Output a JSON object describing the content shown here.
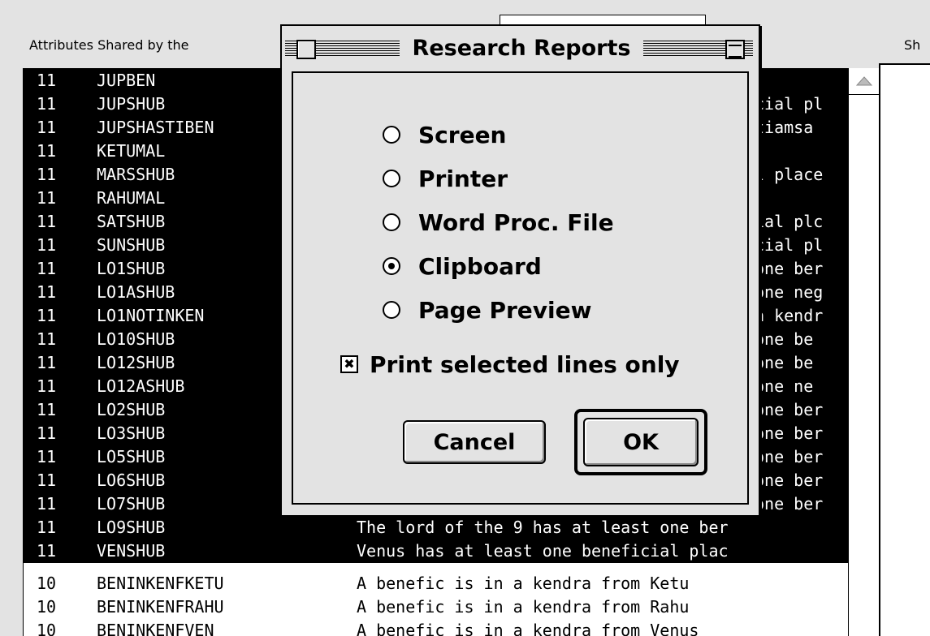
{
  "window": {
    "left_label": "Attributes Shared by the",
    "right_label": "Sh"
  },
  "list": {
    "rows": [
      {
        "count": "11",
        "attr": "JUPBEN",
        "desc": "",
        "selected": true
      },
      {
        "count": "11",
        "attr": "JUPSHUB",
        "desc": "cial pl",
        "selected": true
      },
      {
        "count": "11",
        "attr": "JUPSHASTIBEN",
        "desc": "tiamsa",
        "selected": true
      },
      {
        "count": "11",
        "attr": "KETUMAL",
        "desc": "",
        "selected": true
      },
      {
        "count": "11",
        "attr": "MARSSHUB",
        "desc": "l place",
        "selected": true
      },
      {
        "count": "11",
        "attr": "RAHUMAL",
        "desc": "",
        "selected": true
      },
      {
        "count": "11",
        "attr": "SATSHUB",
        "desc": "ial plc",
        "selected": true
      },
      {
        "count": "11",
        "attr": "SUNSHUB",
        "desc": "cial pl",
        "selected": true
      },
      {
        "count": "11",
        "attr": "LO1SHUB",
        "desc": "one ber",
        "selected": true
      },
      {
        "count": "11",
        "attr": "LO1ASHUB",
        "desc": "one neg",
        "selected": true
      },
      {
        "count": "11",
        "attr": "LO1NOTINKEN",
        "desc": "a kendr",
        "selected": true
      },
      {
        "count": "11",
        "attr": "LO10SHUB",
        "desc": "one be",
        "selected": true
      },
      {
        "count": "11",
        "attr": "LO12SHUB",
        "desc": "one be",
        "selected": true
      },
      {
        "count": "11",
        "attr": "LO12ASHUB",
        "desc": "one ne",
        "selected": true
      },
      {
        "count": "11",
        "attr": "LO2SHUB",
        "desc": "one ber",
        "selected": true
      },
      {
        "count": "11",
        "attr": "LO3SHUB",
        "desc": "one ber",
        "selected": true
      },
      {
        "count": "11",
        "attr": "LO5SHUB",
        "desc": "one ber",
        "selected": true
      },
      {
        "count": "11",
        "attr": "LO6SHUB",
        "desc": "one ber",
        "selected": true
      },
      {
        "count": "11",
        "attr": "LO7SHUB",
        "desc": "one ber",
        "selected": true
      },
      {
        "count": "11",
        "attr": "LO9SHUB",
        "desc": "The lord of the 9 has at least one ber",
        "selected": true
      },
      {
        "count": "11",
        "attr": "VENSHUB",
        "desc": "Venus has at least one beneficial plac",
        "selected": true
      },
      {
        "count": "10",
        "attr": "BENINKENFKETU",
        "desc": "A benefic is in a kendra from Ketu",
        "selected": false
      },
      {
        "count": "10",
        "attr": "BENINKENFRAHU",
        "desc": "A benefic is in a kendra from Rahu",
        "selected": false
      },
      {
        "count": "10",
        "attr": "BENINKENFVEN",
        "desc": "A benefic is in a kendra from Venus",
        "selected": false
      }
    ]
  },
  "dialog": {
    "title": "Research Reports",
    "options": [
      {
        "label": "Screen",
        "selected": false
      },
      {
        "label": "Printer",
        "selected": false
      },
      {
        "label": "Word Proc. File",
        "selected": false
      },
      {
        "label": "Clipboard",
        "selected": true
      },
      {
        "label": "Page Preview",
        "selected": false
      }
    ],
    "checkbox_label": "Print selected lines only",
    "checkbox_checked": true,
    "cancel_label": "Cancel",
    "ok_label": "OK"
  }
}
